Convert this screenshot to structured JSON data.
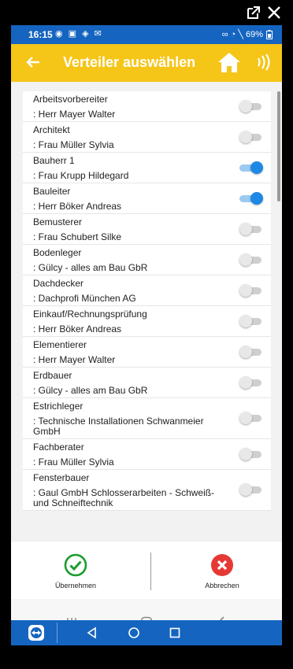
{
  "status_bar": {
    "time": "16:15",
    "left_icons": "◉ ▣ ◈ ✉",
    "right_icons": "∞ ◔ ╲ 69%",
    "battery_icon": "battery-icon"
  },
  "app_bar": {
    "title": "Verteiler auswählen",
    "background": "#f5c518"
  },
  "entries": [
    {
      "role": "Arbeitsvorbereiter",
      "person": ": Herr Mayer Walter",
      "enabled": false
    },
    {
      "role": "Architekt",
      "person": ": Frau Müller Sylvia",
      "enabled": false
    },
    {
      "role": "Bauherr 1",
      "person": ": Frau Krupp Hildegard",
      "enabled": true
    },
    {
      "role": "Bauleiter",
      "person": ": Herr Böker Andreas",
      "enabled": true
    },
    {
      "role": "Bemusterer",
      "person": ": Frau Schubert Silke",
      "enabled": false
    },
    {
      "role": "Bodenleger",
      "person": ":  Gülcy - alles am Bau GbR",
      "enabled": false
    },
    {
      "role": "Dachdecker",
      "person": ":  Dachprofi München AG",
      "enabled": false
    },
    {
      "role": "Einkauf/Rechnungsprüfung",
      "person": ": Herr Böker Andreas",
      "enabled": false
    },
    {
      "role": "Elementierer",
      "person": ": Herr Mayer Walter",
      "enabled": false
    },
    {
      "role": "Erdbauer",
      "person": ":  Gülcy - alles am Bau GbR",
      "enabled": false
    },
    {
      "role": "Estrichleger",
      "person": ":  Technische Installationen Schwanmeier GmbH",
      "enabled": false
    },
    {
      "role": "Fachberater",
      "person": ": Frau Müller Sylvia",
      "enabled": false
    },
    {
      "role": "Fensterbauer",
      "person": ":  Gaul GmbH Schlosserarbeiten - Schweiß- und Schneiftechnik",
      "enabled": false
    }
  ],
  "actions": {
    "accept_label": "Übernehmen",
    "cancel_label": "Abbrechen",
    "accept_color": "#1a9c2e",
    "cancel_color": "#e53935"
  },
  "colors": {
    "status_bar": "#1565c0",
    "switch_on": "#1e88e5"
  }
}
